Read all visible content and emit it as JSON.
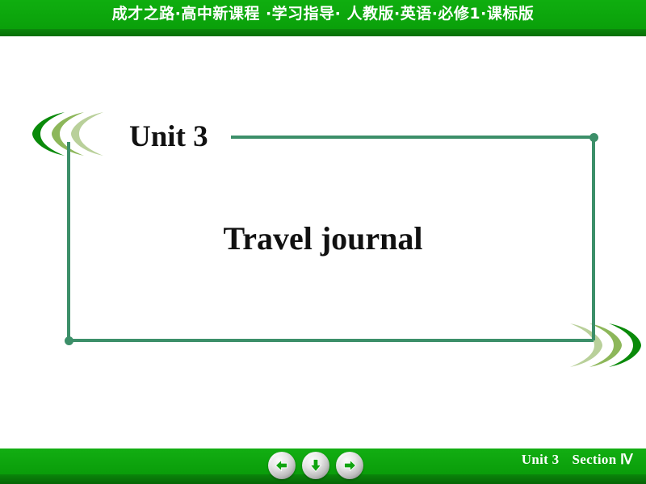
{
  "header": {
    "title": "成才之路·高中新课程 ·学习指导· 人教版·英语·必修1·课标版",
    "bg_color": "#0ba50b",
    "text_color": "#ffffff"
  },
  "slide": {
    "unit_heading": "Unit 3",
    "main_title": "Travel journal",
    "frame_color": "#3c8f69",
    "crescent_colors": [
      "#0a8a0a",
      "#8db75a",
      "#b9d09a"
    ]
  },
  "footer": {
    "unit_label": "Unit 3",
    "section_label": "Section Ⅳ",
    "bg_color": "#0ba50b",
    "text_color": "#ffffff",
    "nav": {
      "prev_label": "previous-slide",
      "down_label": "next-step",
      "next_label": "next-slide",
      "arrow_color": "#0ba50b"
    }
  }
}
